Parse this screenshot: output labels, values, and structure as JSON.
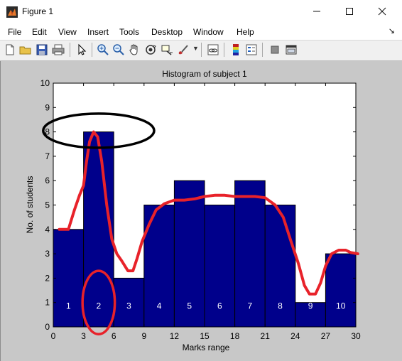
{
  "window": {
    "title": "Figure 1",
    "minimize_icon": "minimize-icon",
    "maximize_icon": "maximize-icon",
    "close_icon": "close-icon"
  },
  "menu": {
    "items": [
      "File",
      "Edit",
      "View",
      "Insert",
      "Tools",
      "Desktop",
      "Window",
      "Help"
    ]
  },
  "toolbar": {
    "icons": [
      "new-figure-icon",
      "open-file-icon",
      "save-icon",
      "print-icon",
      "pointer-icon",
      "zoom-in-icon",
      "zoom-out-icon",
      "pan-icon",
      "rotate-3d-icon",
      "data-cursor-icon",
      "brush-icon",
      "link-plot-icon",
      "colorbar-icon",
      "legend-icon",
      "hide-plot-tools-icon",
      "show-plot-tools-icon"
    ]
  },
  "colors": {
    "bar_fill": "#00008b",
    "bar_edge": "#000000",
    "annotation_red": "#e8222a",
    "annotation_black": "#000000",
    "figure_bg": "#c8c8c8"
  },
  "chart_data": {
    "type": "bar",
    "title": "Histogram of subject 1",
    "xlabel": "Marks range",
    "ylabel": "No. of students",
    "xlim": [
      0,
      30
    ],
    "ylim": [
      0,
      10
    ],
    "xticks": [
      0,
      3,
      6,
      9,
      12,
      15,
      18,
      21,
      24,
      27,
      30
    ],
    "yticks": [
      0,
      1,
      2,
      3,
      4,
      5,
      6,
      7,
      8,
      9,
      10
    ],
    "bin_edges": [
      0,
      3,
      6,
      9,
      12,
      15,
      18,
      21,
      24,
      27,
      30
    ],
    "values": [
      4,
      8,
      2,
      5,
      6,
      5,
      6,
      5,
      1,
      3
    ],
    "bar_labels": [
      "1",
      "2",
      "3",
      "4",
      "5",
      "6",
      "7",
      "8",
      "9",
      "10"
    ],
    "annotations": {
      "red_curve": [
        [
          0.6,
          4
        ],
        [
          1.5,
          4
        ],
        [
          2.1,
          4.8
        ],
        [
          2.6,
          5.4
        ],
        [
          3.0,
          5.8
        ],
        [
          3.3,
          6.8
        ],
        [
          3.6,
          7.6
        ],
        [
          4.0,
          8.0
        ],
        [
          4.4,
          7.8
        ],
        [
          4.8,
          6.8
        ],
        [
          5.3,
          5.0
        ],
        [
          5.8,
          3.6
        ],
        [
          6.3,
          3.0
        ],
        [
          6.8,
          2.7
        ],
        [
          7.4,
          2.3
        ],
        [
          7.9,
          2.3
        ],
        [
          8.3,
          2.8
        ],
        [
          8.8,
          3.5
        ],
        [
          9.5,
          4.2
        ],
        [
          10.2,
          4.8
        ],
        [
          11.0,
          5.05
        ],
        [
          12.0,
          5.2
        ],
        [
          13.0,
          5.2
        ],
        [
          14.0,
          5.25
        ],
        [
          15.0,
          5.35
        ],
        [
          16.0,
          5.4
        ],
        [
          17.0,
          5.4
        ],
        [
          18.0,
          5.35
        ],
        [
          19.0,
          5.35
        ],
        [
          20.0,
          5.35
        ],
        [
          21.0,
          5.3
        ],
        [
          22.0,
          5.0
        ],
        [
          22.8,
          4.5
        ],
        [
          23.5,
          3.6
        ],
        [
          24.3,
          2.6
        ],
        [
          24.9,
          1.7
        ],
        [
          25.4,
          1.35
        ],
        [
          26.0,
          1.35
        ],
        [
          26.5,
          1.8
        ],
        [
          27.0,
          2.5
        ],
        [
          27.6,
          3.0
        ],
        [
          28.3,
          3.15
        ],
        [
          29.0,
          3.15
        ],
        [
          29.5,
          3.05
        ],
        [
          30.2,
          3.0
        ]
      ],
      "red_ellipse": {
        "cx": 4.5,
        "cy": 1.0,
        "rx": 1.6,
        "ry": 1.3
      },
      "black_ellipse": {
        "cx": 4.5,
        "cy": 8.05,
        "rx": 5.5,
        "ry": 0.7
      }
    }
  }
}
